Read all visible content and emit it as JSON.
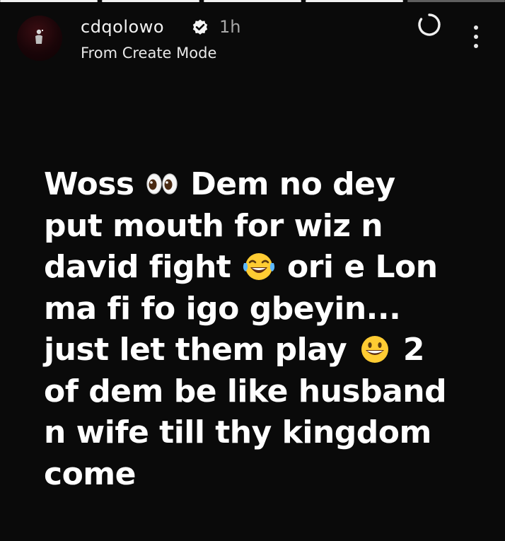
{
  "story": {
    "progress_segments": 5,
    "current_segment": 5
  },
  "header": {
    "username": "cdqolowo",
    "verified": true,
    "time": "1h",
    "subtitle": "From Create Mode"
  },
  "icons": {
    "avatar": "profile-avatar",
    "verified": "verified-badge-icon",
    "loading": "loading-spinner-icon",
    "menu": "more-vertical-icon",
    "emoji_eyes": "eyes-emoji-icon",
    "emoji_laugh": "tears-of-joy-emoji-icon",
    "emoji_grin": "grinning-face-emoji-icon"
  },
  "text": {
    "l1_a": "Woss",
    "l1_b": "Dem no dey",
    "l2": "put mouth for wiz n",
    "l3_a": "david fight",
    "l3_b": "ori e Lon",
    "l4": "ma fi fo igo gbeyin...",
    "l5_a": "just let them play",
    "l5_b": "2",
    "l6": "of dem be like husband",
    "l7": "n wife till thy kingdom",
    "l8": "come"
  },
  "colors": {
    "background": "#0a0a0a",
    "text": "#ffffff",
    "muted": "#a8a8a8"
  }
}
